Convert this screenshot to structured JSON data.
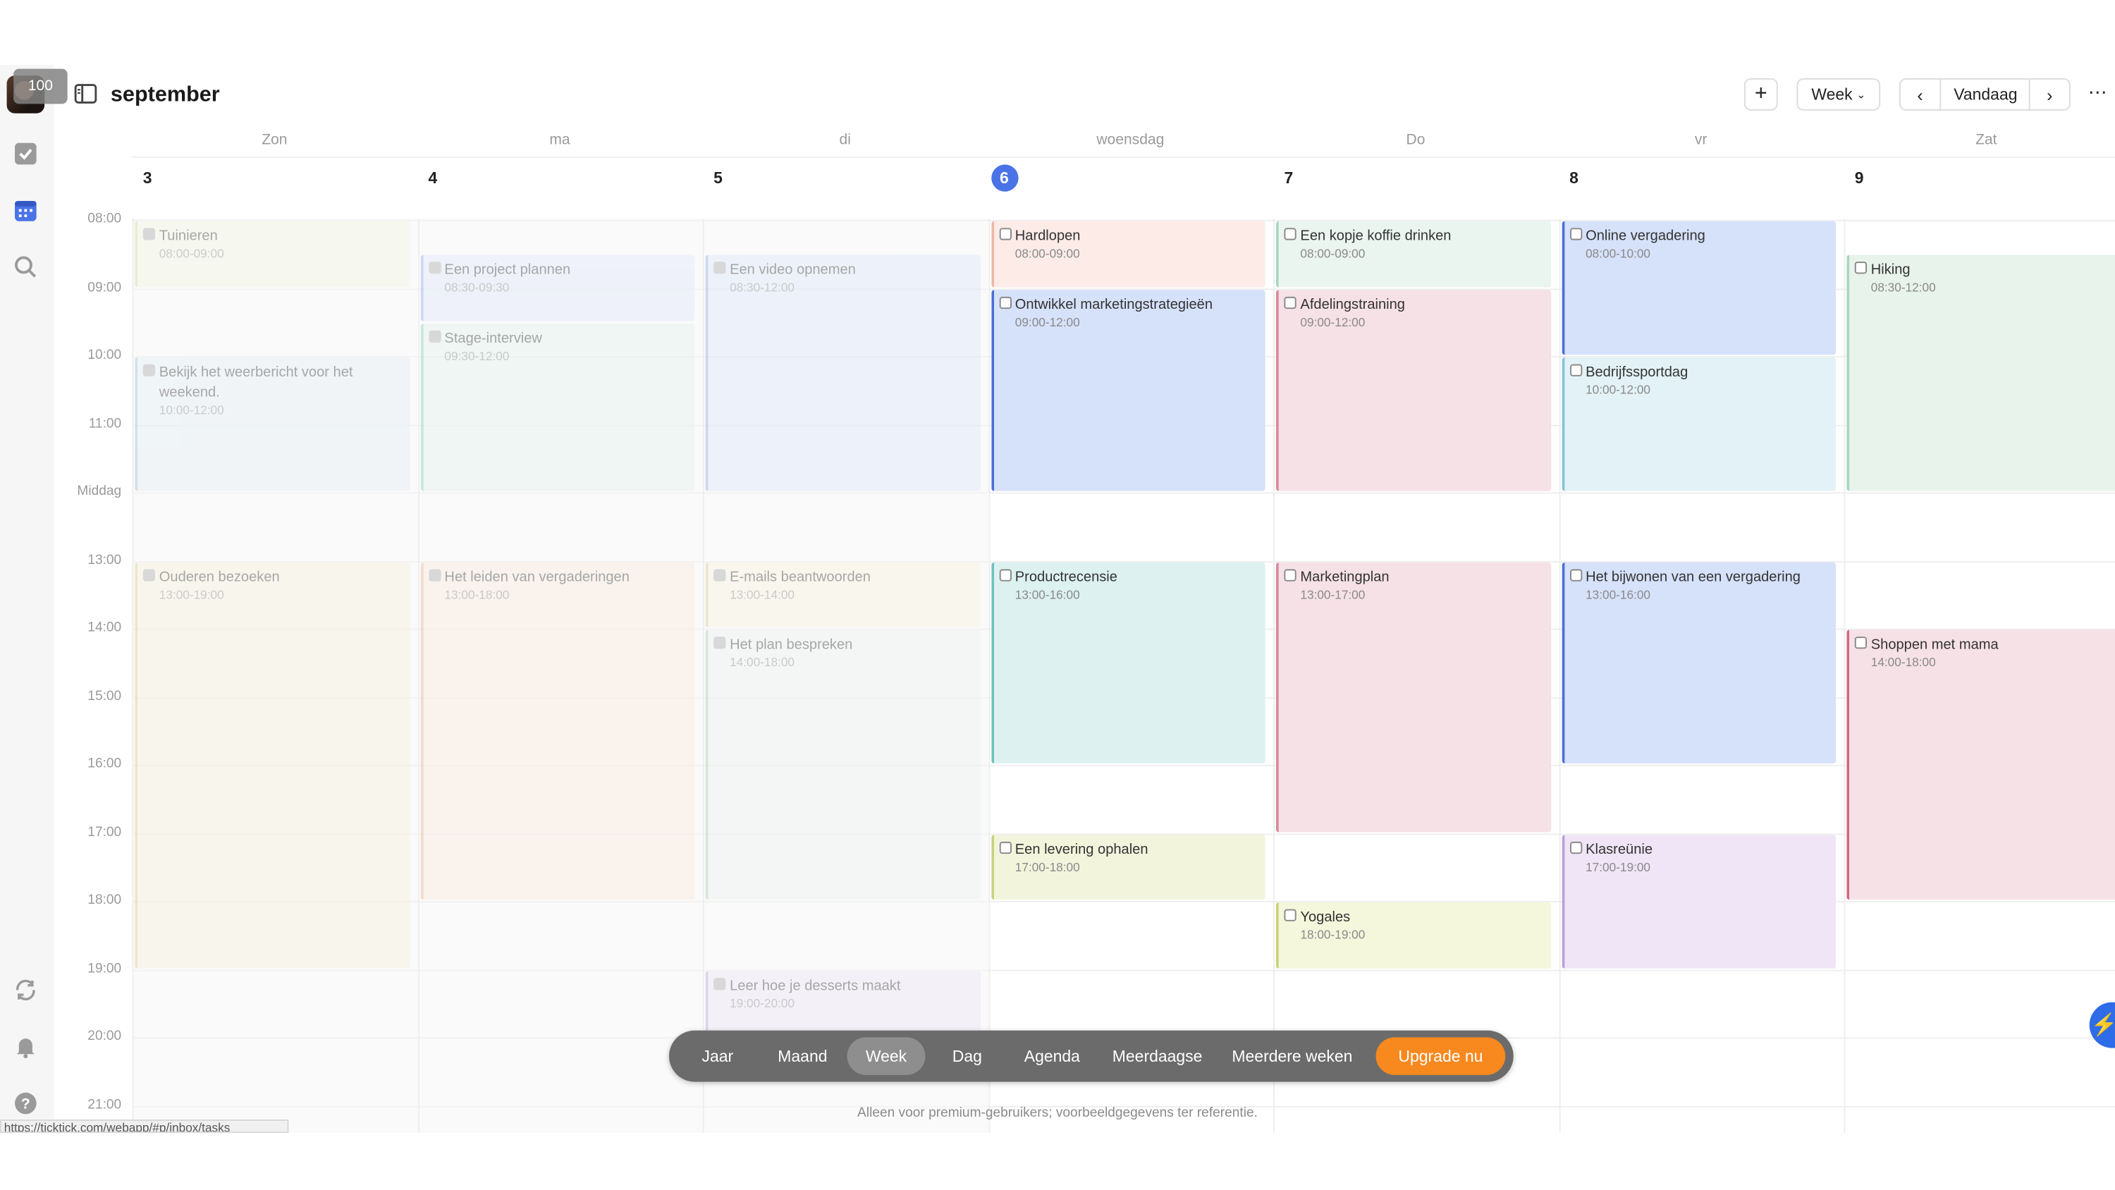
{
  "header": {
    "month_title": "september",
    "add_label": "+",
    "view_label": "Week",
    "today_label": "Vandaag",
    "more_label": "⋯"
  },
  "avatar": {
    "badge": "100"
  },
  "day_names": [
    "Zon",
    "ma",
    "di",
    "woensdag",
    "Do",
    "vr",
    "Zat"
  ],
  "day_numbers": [
    "3",
    "4",
    "5",
    "6",
    "7",
    "8",
    "9"
  ],
  "today_index": 3,
  "hours": [
    "08:00",
    "09:00",
    "10:00",
    "11:00",
    "Middag",
    "13:00",
    "14:00",
    "15:00",
    "16:00",
    "17:00",
    "18:00",
    "19:00",
    "20:00",
    "21:00"
  ],
  "events": [
    {
      "day": 0,
      "start": 8,
      "end": 9,
      "title": "Tuinieren",
      "time": "08:00-09:00",
      "color": "#f1f6e3",
      "border": "#c9dc9a",
      "past": true
    },
    {
      "day": 0,
      "start": 10,
      "end": 12,
      "title": "Bekijk het weerbericht voor het weekend.",
      "time": "10:00-12:00",
      "color": "#e3eef5",
      "border": "#9cc0d8",
      "past": true
    },
    {
      "day": 0,
      "start": 13,
      "end": 19,
      "title": "Ouderen bezoeken",
      "time": "13:00-19:00",
      "color": "#f5f0d9",
      "border": "#d9cc8a",
      "past": true
    },
    {
      "day": 1,
      "start": 8.5,
      "end": 9.5,
      "title": "Een project plannen",
      "time": "08:30-09:30",
      "color": "#dfe7f9",
      "border": "#8ea8e6",
      "past": true
    },
    {
      "day": 1,
      "start": 9.5,
      "end": 12,
      "title": "Stage-interview",
      "time": "09:30-12:00",
      "color": "#e0f2ee",
      "border": "#88c9b8",
      "past": true
    },
    {
      "day": 1,
      "start": 13,
      "end": 18,
      "title": "Het leiden van vergaderingen",
      "time": "13:00-18:00",
      "color": "#f9e9dc",
      "border": "#e6b48e",
      "past": true
    },
    {
      "day": 2,
      "start": 8.5,
      "end": 12,
      "title": "Een video opnemen",
      "time": "08:30-12:00",
      "color": "#dce6f9",
      "border": "#8ea8e6",
      "past": true
    },
    {
      "day": 2,
      "start": 13,
      "end": 14,
      "title": "E-mails beantwoorden",
      "time": "13:00-14:00",
      "color": "#f7f2dc",
      "border": "#d9cc8a",
      "past": true
    },
    {
      "day": 2,
      "start": 14,
      "end": 18,
      "title": "Het plan bespreken",
      "time": "14:00-18:00",
      "color": "#eaf2ec",
      "border": "#a8cdb2",
      "past": true
    },
    {
      "day": 2,
      "start": 19,
      "end": 20,
      "title": "Leer hoe je desserts maakt",
      "time": "19:00-20:00",
      "color": "#ece3f5",
      "border": "#b9a0d8",
      "past": true
    },
    {
      "day": 3,
      "start": 8,
      "end": 9,
      "title": "Hardlopen",
      "time": "08:00-09:00",
      "color": "#fcebe6",
      "border": "#f0b5a4",
      "past": false
    },
    {
      "day": 3,
      "start": 9,
      "end": 12,
      "title": "Ontwikkel marketingstrategieën",
      "time": "09:00-12:00",
      "color": "#d6e1fa",
      "border": "#4a6fd8",
      "past": false
    },
    {
      "day": 3,
      "start": 13,
      "end": 16,
      "title": "Productrecensie",
      "time": "13:00-16:00",
      "color": "#dcf1f0",
      "border": "#6cc2be",
      "past": false
    },
    {
      "day": 3,
      "start": 17,
      "end": 18,
      "title": "Een levering ophalen",
      "time": "17:00-18:00",
      "color": "#f2f5dc",
      "border": "#c8d27a",
      "past": false
    },
    {
      "day": 4,
      "start": 8,
      "end": 9,
      "title": "Een kopje koffie drinken",
      "time": "08:00-09:00",
      "color": "#ebf5f0",
      "border": "#a9d6bf",
      "past": false
    },
    {
      "day": 4,
      "start": 9,
      "end": 12,
      "title": "Afdelingstraining",
      "time": "09:00-12:00",
      "color": "#f6e1e6",
      "border": "#d98a9c",
      "past": false
    },
    {
      "day": 4,
      "start": 13,
      "end": 17,
      "title": "Marketingplan",
      "time": "13:00-17:00",
      "color": "#f6e1e6",
      "border": "#d98a9c",
      "past": false
    },
    {
      "day": 4,
      "start": 18,
      "end": 19,
      "title": "Yogales",
      "time": "18:00-19:00",
      "color": "#f4f7dc",
      "border": "#c8d27a",
      "past": false
    },
    {
      "day": 5,
      "start": 8,
      "end": 10,
      "title": "Online vergadering",
      "time": "08:00-10:00",
      "color": "#d6e1fa",
      "border": "#4a6fd8",
      "past": false
    },
    {
      "day": 5,
      "start": 10,
      "end": 12,
      "title": "Bedrijfssportdag",
      "time": "10:00-12:00",
      "color": "#e3f2f6",
      "border": "#86c3d6",
      "past": false
    },
    {
      "day": 5,
      "start": 13,
      "end": 16,
      "title": "Het bijwonen van een vergadering",
      "time": "13:00-16:00",
      "color": "#d6e1fa",
      "border": "#4a6fd8",
      "past": false
    },
    {
      "day": 5,
      "start": 17,
      "end": 19,
      "title": "Klasreünie",
      "time": "17:00-19:00",
      "color": "#efe5f6",
      "border": "#b9a0d8",
      "past": false
    },
    {
      "day": 6,
      "start": 8.5,
      "end": 12,
      "title": "Hiking",
      "time": "08:30-12:00",
      "color": "#e8f3ec",
      "border": "#a9d6bf",
      "past": false
    },
    {
      "day": 6,
      "start": 14,
      "end": 18,
      "title": "Shoppen met mama",
      "time": "14:00-18:00",
      "color": "#f6e1e6",
      "border": "#d06a82",
      "past": false
    }
  ],
  "bottom_bar": {
    "items": [
      "Jaar",
      "Maand",
      "Week",
      "Dag",
      "Agenda",
      "Meerdaagse",
      "Meerdere weken"
    ],
    "active": "Week",
    "upgrade_label": "Upgrade nu"
  },
  "footer_note": "Alleen voor premium-gebruikers; voorbeeldgegevens ter referentie.",
  "status_url": "https://ticktick.com/webapp/#p/inbox/tasks",
  "colors": {
    "today": "#4a73e8",
    "upgrade": "#f7891f",
    "accent": "#2f6ce8"
  }
}
